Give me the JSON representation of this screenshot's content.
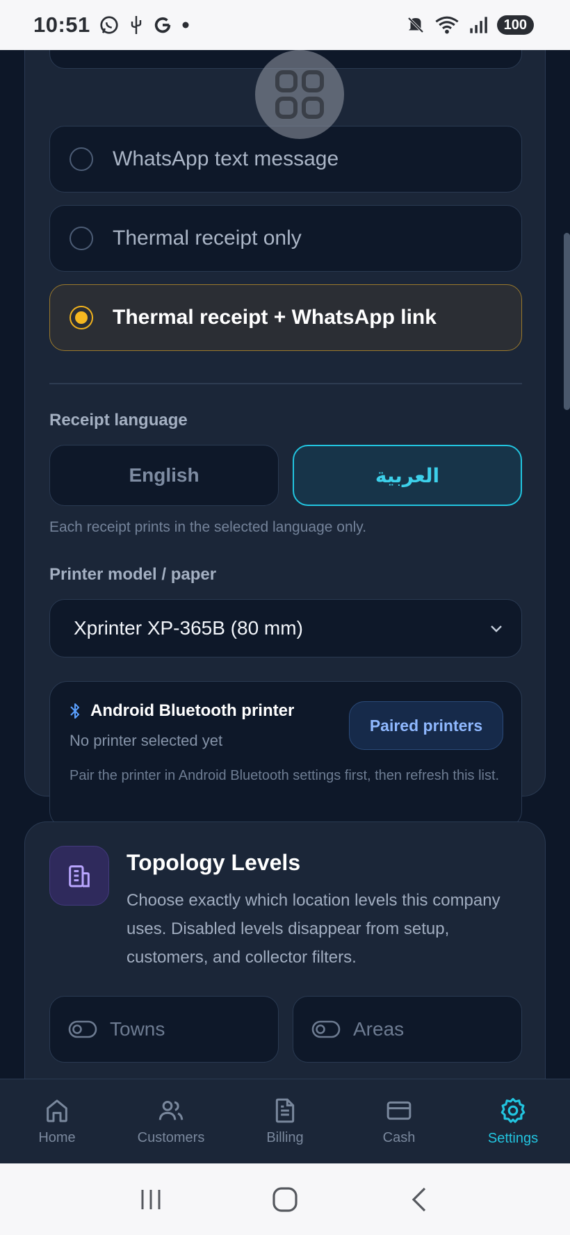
{
  "status_bar": {
    "time": "10:51",
    "battery": "100"
  },
  "delivery_options": [
    {
      "label": "WhatsApp text message",
      "selected": false
    },
    {
      "label": "Thermal receipt only",
      "selected": false
    },
    {
      "label": "Thermal receipt + WhatsApp link",
      "selected": true
    }
  ],
  "receipt_language": {
    "label": "Receipt language",
    "english": "English",
    "arabic": "العربية",
    "selected": "arabic",
    "hint": "Each receipt prints in the selected language only."
  },
  "printer": {
    "label": "Printer model / paper",
    "selected_model": "Xprinter XP-365B (80 mm)",
    "bluetooth_title": "Android Bluetooth printer",
    "status": "No printer selected yet",
    "paired_button": "Paired printers",
    "description": "Pair the printer in Android Bluetooth settings first, then refresh this list."
  },
  "topology": {
    "title": "Topology Levels",
    "description": "Choose exactly which location levels this company uses. Disabled levels disappear from setup, customers, and collector filters.",
    "levels": [
      "Towns",
      "Areas"
    ]
  },
  "nav": {
    "items": [
      {
        "label": "Home",
        "icon": "home-icon"
      },
      {
        "label": "Customers",
        "icon": "users-icon"
      },
      {
        "label": "Billing",
        "icon": "document-icon"
      },
      {
        "label": "Cash",
        "icon": "card-icon"
      },
      {
        "label": "Settings",
        "icon": "gear-icon"
      }
    ],
    "active": "Settings"
  },
  "colors": {
    "accent": "#22c5e0",
    "selected_radio": "#f6b820",
    "background": "#0d1728"
  }
}
